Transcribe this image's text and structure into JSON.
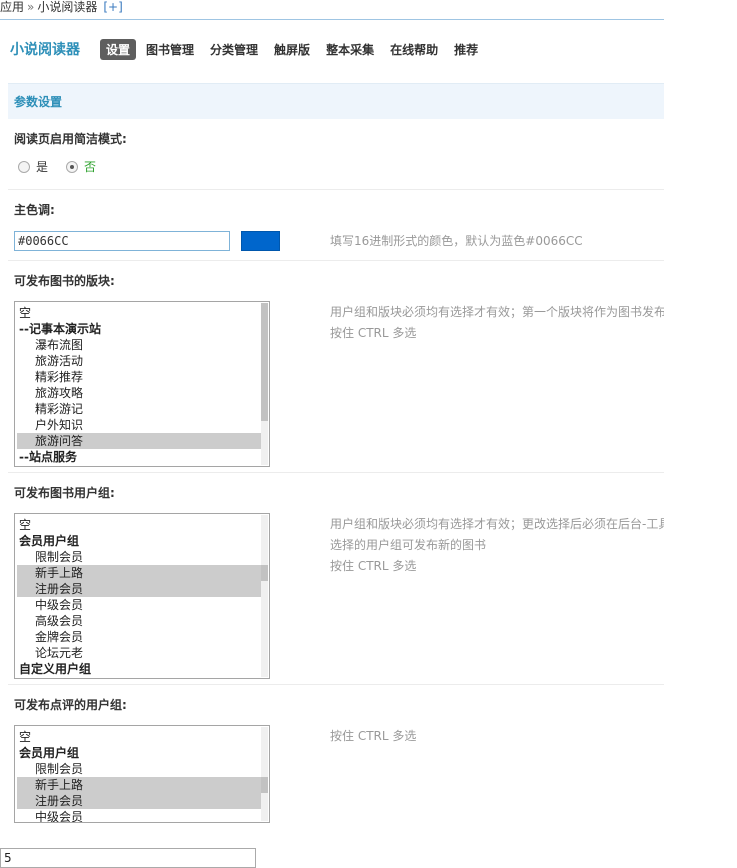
{
  "breadcrumb": {
    "root": "应用",
    "separator": "»",
    "current": "小说阅读器",
    "add": "[+]"
  },
  "header": {
    "app_title": "小说阅读器",
    "nav": [
      {
        "label": "设置",
        "active": true
      },
      {
        "label": "图书管理"
      },
      {
        "label": "分类管理"
      },
      {
        "label": "触屏版"
      },
      {
        "label": "整本采集"
      },
      {
        "label": "在线帮助"
      },
      {
        "label": "推荐"
      }
    ]
  },
  "section": {
    "title": "参数设置"
  },
  "simple_mode": {
    "label": "阅读页启用简洁模式:",
    "options": [
      {
        "label": "是",
        "checked": false
      },
      {
        "label": "否",
        "checked": true
      }
    ]
  },
  "main_color": {
    "label": "主色调:",
    "value": "#0066CC",
    "swatch_color": "#0066CC",
    "hint": "填写16进制形式的颜色，默认为蓝色#0066CC"
  },
  "forums": {
    "label": "可发布图书的版块:",
    "hint_line1": "用户组和版块必须均有选择才有效；第一个版块将作为图书发布",
    "hint_line2": "按住 CTRL 多选",
    "options": [
      {
        "label": "空",
        "kind": "plain"
      },
      {
        "label": "--记事本演示站",
        "kind": "group"
      },
      {
        "label": "瀑布流图",
        "kind": "child"
      },
      {
        "label": "旅游活动",
        "kind": "child"
      },
      {
        "label": "精彩推荐",
        "kind": "child"
      },
      {
        "label": "旅游攻略",
        "kind": "child"
      },
      {
        "label": "精彩游记",
        "kind": "child"
      },
      {
        "label": "户外知识",
        "kind": "child"
      },
      {
        "label": "旅游问答",
        "kind": "child",
        "selected": true
      },
      {
        "label": "--站点服务",
        "kind": "group"
      }
    ]
  },
  "publish_groups": {
    "label": "可发布图书用户组:",
    "hint_line1": "用户组和版块必须均有选择才有效；更改选择后必须在后台-工具",
    "hint_line2": "选择的用户组可发布新的图书",
    "hint_line3": "按住 CTRL 多选",
    "options": [
      {
        "label": "空",
        "kind": "plain"
      },
      {
        "label": "会员用户组",
        "kind": "group"
      },
      {
        "label": "限制会员",
        "kind": "child"
      },
      {
        "label": "新手上路",
        "kind": "child",
        "selected": true
      },
      {
        "label": "注册会员",
        "kind": "child",
        "selected": true
      },
      {
        "label": "中级会员",
        "kind": "child"
      },
      {
        "label": "高级会员",
        "kind": "child"
      },
      {
        "label": "金牌会员",
        "kind": "child"
      },
      {
        "label": "论坛元老",
        "kind": "child"
      },
      {
        "label": "自定义用户组",
        "kind": "group"
      }
    ]
  },
  "review_groups": {
    "label": "可发布点评的用户组:",
    "hint_line1": "按住 CTRL 多选",
    "options": [
      {
        "label": "空",
        "kind": "plain"
      },
      {
        "label": "会员用户组",
        "kind": "group"
      },
      {
        "label": "限制会员",
        "kind": "child"
      },
      {
        "label": "新手上路",
        "kind": "child",
        "selected": true
      },
      {
        "label": "注册会员",
        "kind": "child",
        "selected": true
      },
      {
        "label": "中级会员",
        "kind": "child"
      }
    ]
  },
  "bottom_field": {
    "value": "5"
  }
}
